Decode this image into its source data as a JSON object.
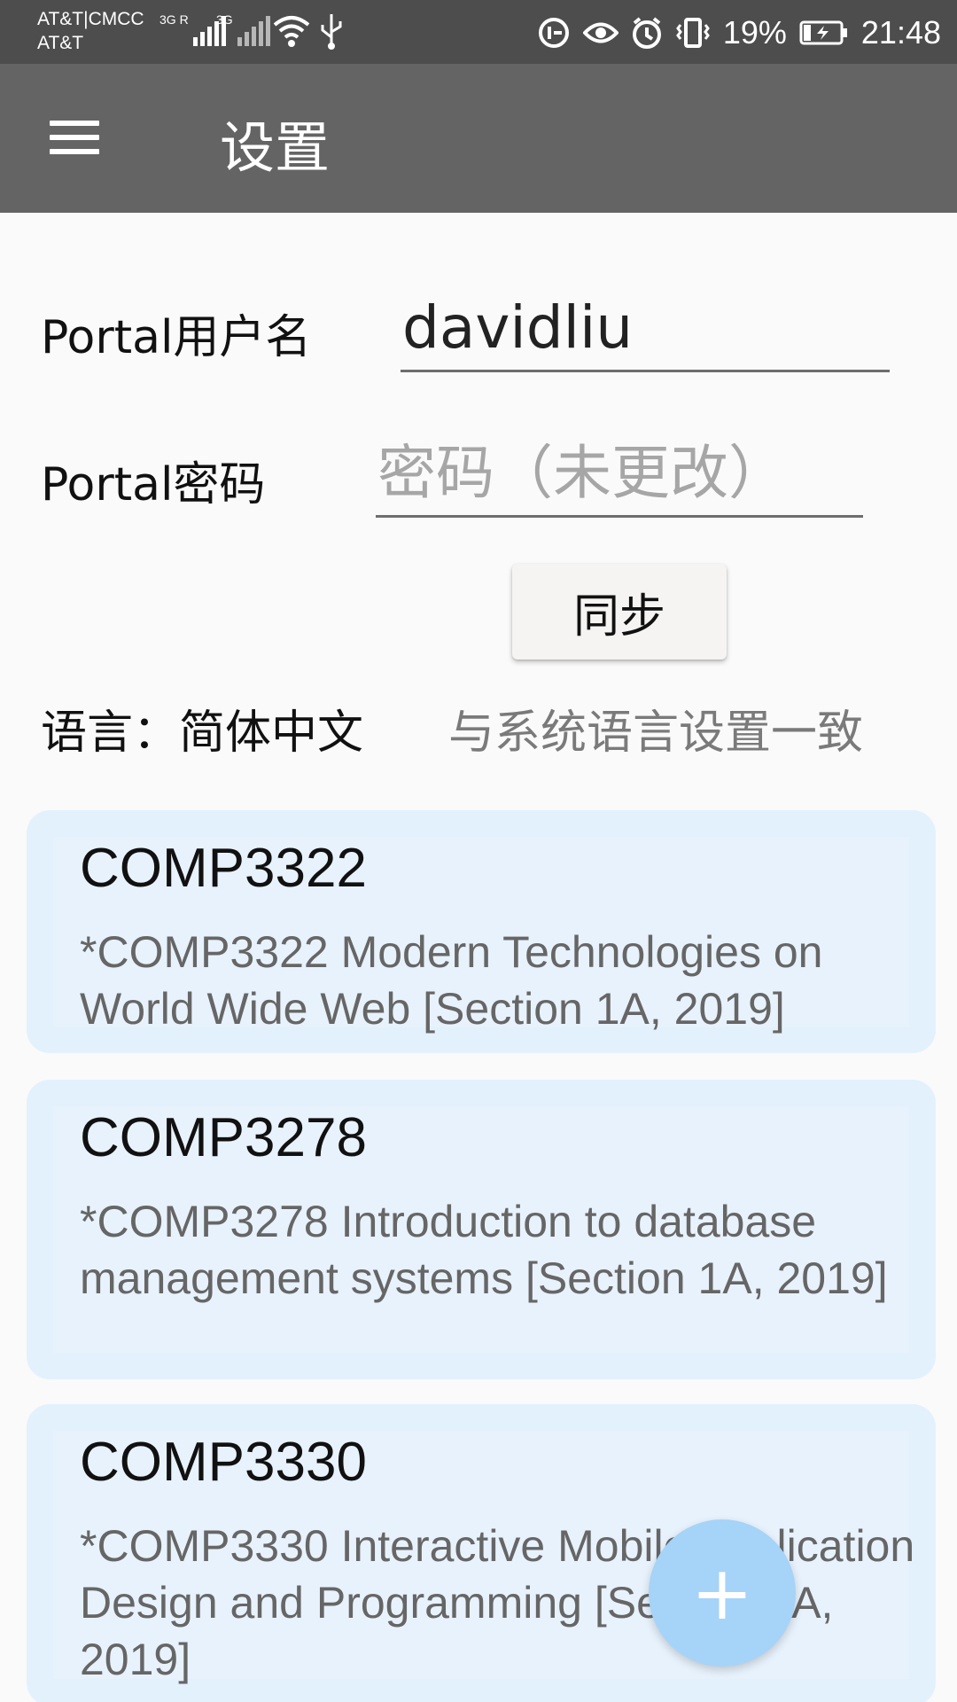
{
  "status_bar": {
    "carrier_line1": "AT&T|CMCC",
    "carrier_line2": "AT&T",
    "network_tag_1": "3G R",
    "network_tag_2": "3G",
    "battery_percent": "19%",
    "time": "21:48",
    "icons": [
      "signal-icon",
      "wifi-icon",
      "usb-icon",
      "data-saver-icon",
      "eye-icon",
      "alarm-icon",
      "vibrate-icon",
      "battery-charging-icon"
    ]
  },
  "app_bar": {
    "title": "设置",
    "menu_icon": "hamburger-menu-icon"
  },
  "form": {
    "username_label": "Portal用户名",
    "username_value": "davidliu",
    "password_label": "Portal密码",
    "password_placeholder": "密码（未更改）",
    "sync_label": "同步"
  },
  "language": {
    "label": "语言：简体中文",
    "hint": "与系统语言设置一致"
  },
  "courses": [
    {
      "code": "COMP3322",
      "description": "*COMP3322 Modern Technologies on World Wide Web [Section 1A, 2019]"
    },
    {
      "code": "COMP3278",
      "description": "*COMP3278 Introduction to database management systems [Section 1A, 2019]"
    },
    {
      "code": "COMP3330",
      "description": "*COMP3330 Interactive Mobile Application Design and Programming [Section 1A, 2019]"
    }
  ],
  "fab": {
    "label": "+",
    "icon": "plus-icon"
  },
  "colors": {
    "status_bar": "#4d4d4d",
    "app_bar": "#646464",
    "card_bg": "#e3f1fd",
    "fab": "#a6d3f8"
  }
}
